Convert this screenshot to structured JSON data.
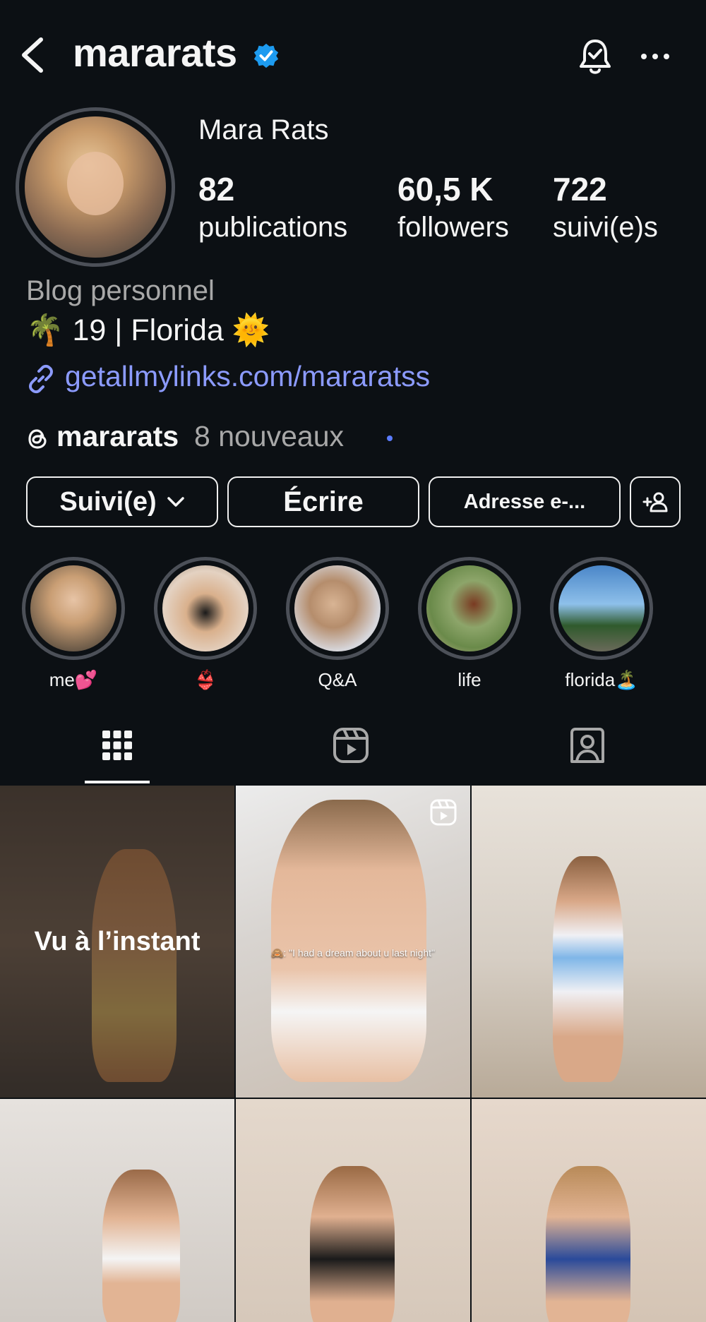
{
  "header": {
    "username": "mararats",
    "icons": {
      "back": "chevron-left-icon",
      "verified": "verified-badge-icon",
      "bell": "notification-bell-icon",
      "more": "more-horizontal-icon"
    },
    "accent": "#1d9bf0"
  },
  "profile": {
    "display_name": "Mara Rats",
    "stats": [
      {
        "value": "82",
        "label": "publications"
      },
      {
        "value": "60,5 K",
        "label": "followers"
      },
      {
        "value": "722",
        "label": "suivi(e)s"
      }
    ],
    "category": "Blog personnel",
    "bio": "🌴 19 | Florida 🌞",
    "link": "getallmylinks.com/mararatss",
    "threads": {
      "name": "mararats",
      "new_label": "8 nouveaux"
    }
  },
  "buttons": {
    "follow": "Suivi(e)",
    "write": "Écrire",
    "email": "Adresse e-..."
  },
  "highlights": [
    {
      "label": "me💕"
    },
    {
      "label": "👙"
    },
    {
      "label": "Q&A"
    },
    {
      "label": "life"
    },
    {
      "label": "florida🏝️"
    }
  ],
  "tabs": [
    {
      "name": "grid",
      "icon": "grid-icon",
      "active": true
    },
    {
      "name": "reels",
      "icon": "reels-icon",
      "active": false
    },
    {
      "name": "tagged",
      "icon": "tagged-person-icon",
      "active": false
    }
  ],
  "grid": {
    "seen_label": "Vu à l’instant",
    "reel_caption": "🙈: \"I had a dream about u last night\""
  }
}
